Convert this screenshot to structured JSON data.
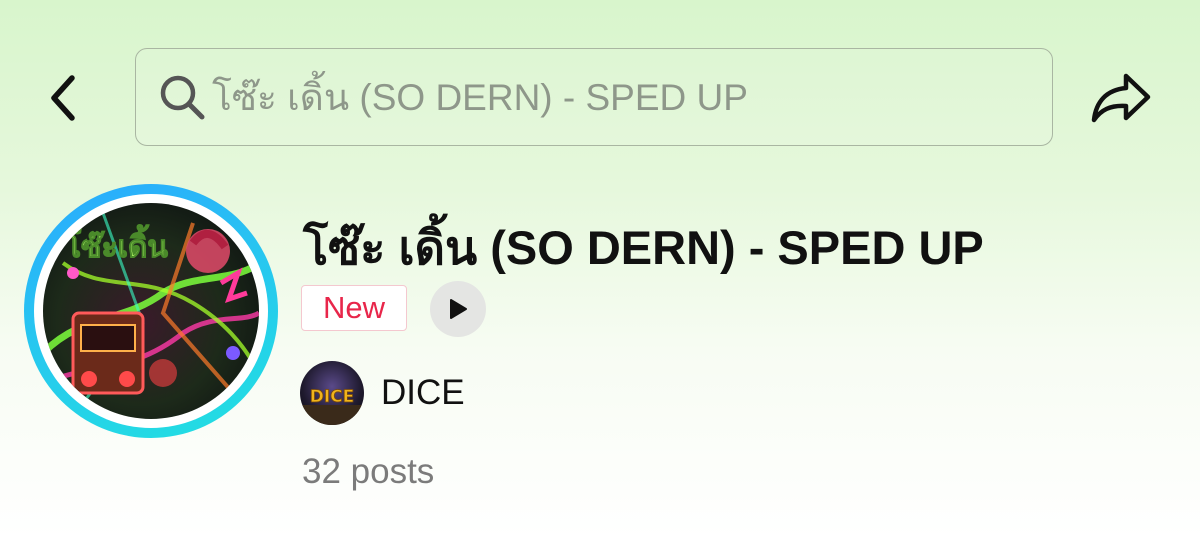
{
  "header": {
    "back_icon": "chevron-left-icon",
    "share_icon": "share-arrow-icon",
    "search": {
      "icon": "search-icon",
      "text": "โซ๊ะ เดิ้น (SO DERN) - SPED UP"
    }
  },
  "sound": {
    "title": "โซ๊ะ เดิ้น (SO DERN) - SPED UP",
    "badge": "New",
    "play_icon": "play-icon",
    "artist": "DICE",
    "artist_logo_text": "DICE",
    "posts": "32 posts",
    "cover_art_text": "โซ๊ะเดิ้น"
  },
  "colors": {
    "badge_text": "#e8264a",
    "ring_start": "#2aa8ff",
    "ring_end": "#22e0e0",
    "background_top": "#d8f5cc"
  }
}
